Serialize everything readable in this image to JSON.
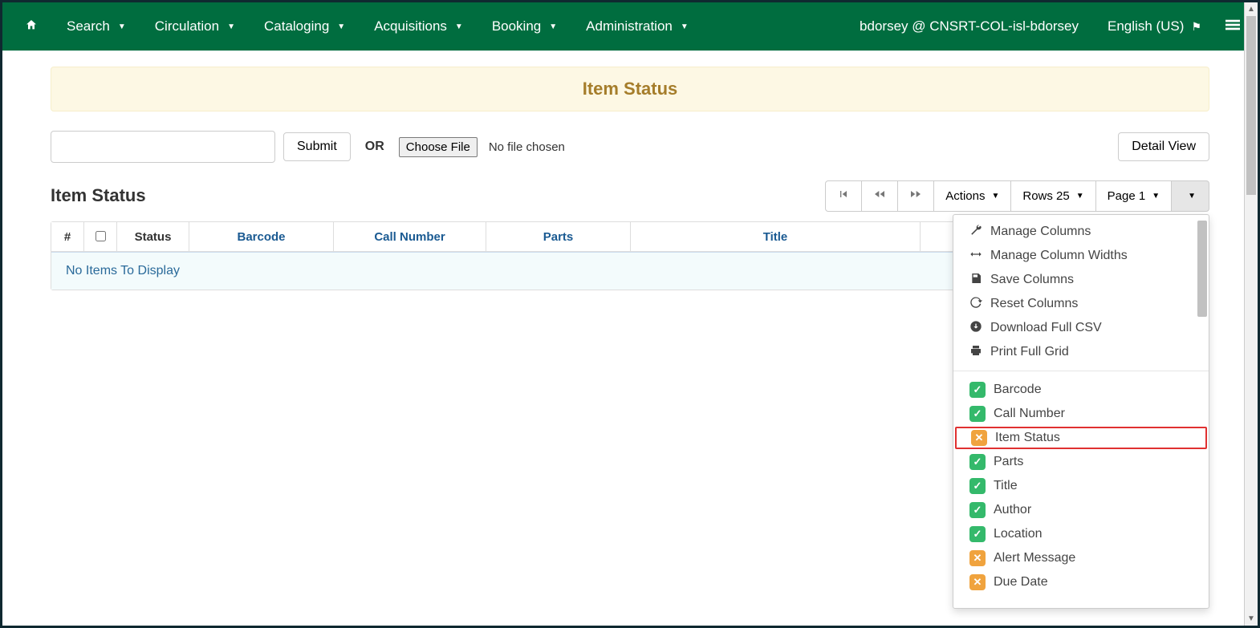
{
  "nav": {
    "items": [
      "Search",
      "Circulation",
      "Cataloging",
      "Acquisitions",
      "Booking",
      "Administration"
    ],
    "user_text": "bdorsey @ CNSRT-COL-isl-bdorsey",
    "locale": "English (US)"
  },
  "banner": {
    "title": "Item Status"
  },
  "toolbar": {
    "submit": "Submit",
    "or": "OR",
    "choose_file": "Choose File",
    "no_file": "No file chosen",
    "detail_view": "Detail View"
  },
  "section_title": "Item Status",
  "grid_controls": {
    "actions": "Actions",
    "rows": "Rows 25",
    "page": "Page 1"
  },
  "columns": {
    "num": "#",
    "status": "Status",
    "barcode": "Barcode",
    "call_number": "Call Number",
    "parts": "Parts",
    "title": "Title",
    "empty": "No Items To Display"
  },
  "dropdown": {
    "actions": [
      {
        "icon": "wrench",
        "label": "Manage Columns"
      },
      {
        "icon": "arrows-h",
        "label": "Manage Column Widths"
      },
      {
        "icon": "save",
        "label": "Save Columns"
      },
      {
        "icon": "refresh",
        "label": "Reset Columns"
      },
      {
        "icon": "download",
        "label": "Download Full CSV"
      },
      {
        "icon": "print",
        "label": "Print Full Grid"
      }
    ],
    "columns": [
      {
        "label": "Barcode",
        "on": true
      },
      {
        "label": "Call Number",
        "on": true
      },
      {
        "label": "Item Status",
        "on": false,
        "highlight": true
      },
      {
        "label": "Parts",
        "on": true
      },
      {
        "label": "Title",
        "on": true
      },
      {
        "label": "Author",
        "on": true
      },
      {
        "label": "Location",
        "on": true
      },
      {
        "label": "Alert Message",
        "on": false
      },
      {
        "label": "Due Date",
        "on": false
      }
    ]
  }
}
